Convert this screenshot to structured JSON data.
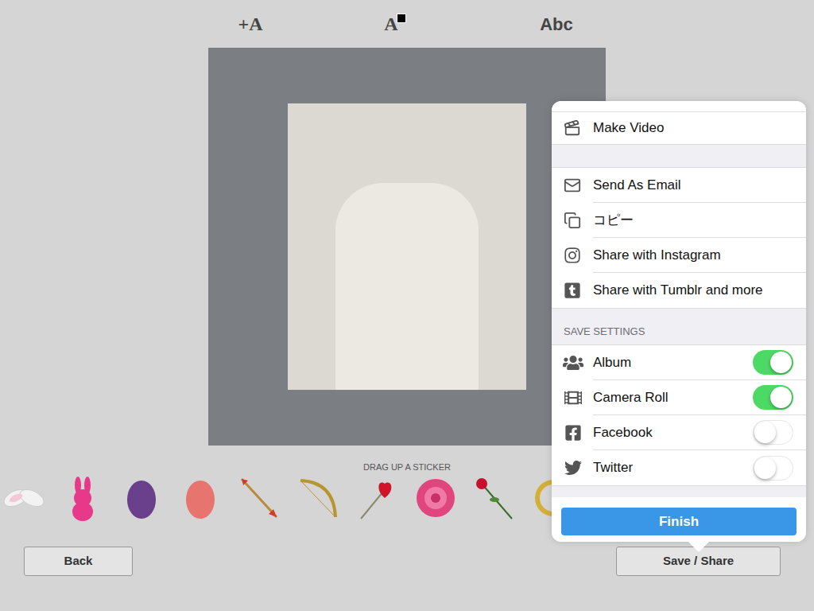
{
  "toolbar": [
    {
      "label": "+A",
      "kind": "add-text"
    },
    {
      "label": "A",
      "kind": "text-color"
    },
    {
      "label": "Abc",
      "kind": "font"
    }
  ],
  "sticker_hint": "DRAG UP A STICKER",
  "stickers": [
    {
      "kind": "ears",
      "color": "#f2f2f2"
    },
    {
      "kind": "bunny",
      "color": "#e8388a"
    },
    {
      "kind": "egg",
      "color": "#6a3f8c"
    },
    {
      "kind": "egg",
      "color": "#e8746f"
    },
    {
      "kind": "arrow",
      "color": "#d33a2c"
    },
    {
      "kind": "bow",
      "color": "#b8962f"
    },
    {
      "kind": "lollipop",
      "color": "#d0142a"
    },
    {
      "kind": "rose",
      "color": "#e0457e"
    },
    {
      "kind": "stem-rose",
      "color": "#c8102e"
    },
    {
      "kind": "ring",
      "color": "#d4af37"
    }
  ],
  "buttons": {
    "back": "Back",
    "save": "Save / Share"
  },
  "share_menu": {
    "top_action": "Make Video",
    "actions": [
      "Send As Email",
      "コピー",
      "Share with Instagram",
      "Share with Tumblr and more"
    ],
    "section": "SAVE SETTINGS",
    "settings": [
      {
        "label": "Album",
        "on": true
      },
      {
        "label": "Camera Roll",
        "on": true
      },
      {
        "label": "Facebook",
        "on": false
      },
      {
        "label": "Twitter",
        "on": false
      }
    ],
    "finish": "Finish"
  }
}
